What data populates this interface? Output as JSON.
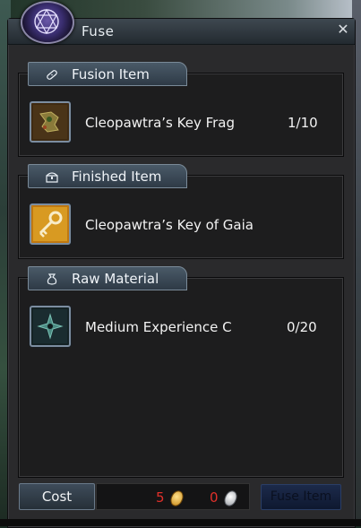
{
  "window": {
    "title": "Fuse"
  },
  "sections": {
    "fusion": {
      "label": "Fusion Item",
      "icon": "bandage-icon",
      "item": {
        "name": "Cleopawtra’s Key Frag",
        "count": "1/10"
      }
    },
    "finished": {
      "label": "Finished Item",
      "icon": "treasure-chest-icon",
      "item": {
        "name": "Cleopawtra’s Key of Gaia"
      }
    },
    "raw": {
      "label": "Raw Material",
      "icon": "pouch-icon",
      "item": {
        "name": "Medium Experience C",
        "count": "0/20"
      }
    }
  },
  "footer": {
    "cost_label": "Cost",
    "gold": "5",
    "silver": "0",
    "fuse_label": "Fuse Item"
  },
  "colors": {
    "accent_red": "#e0302a",
    "frame": "#2a2a2c"
  }
}
